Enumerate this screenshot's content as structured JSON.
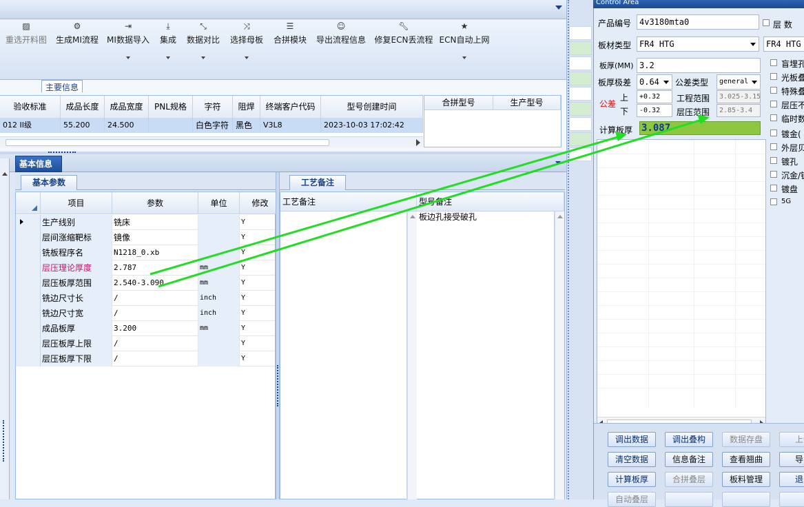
{
  "toolbar": {
    "buttons": [
      {
        "label": "重选开料图",
        "icon": "image-icon"
      },
      {
        "label": "生成MI流程",
        "icon": "gears-icon"
      },
      {
        "label": "MI数据导入",
        "icon": "import-icon"
      },
      {
        "label": "集成",
        "icon": "download-icon"
      },
      {
        "label": "数据对比",
        "icon": "compress-icon"
      },
      {
        "label": "选择母板",
        "icon": "shuffle-icon"
      },
      {
        "label": "合拼模块",
        "icon": "list-icon"
      },
      {
        "label": "导出流程信息",
        "icon": "smile-icon"
      },
      {
        "label": "修复ECN丢流程",
        "icon": "wrench-icon"
      },
      {
        "label": "ECN自动上网",
        "icon": "star-icon"
      }
    ]
  },
  "main_info": {
    "tab": "主要信息",
    "headers": [
      "验收标准",
      "成品长度",
      "成品宽度",
      "PNL规格",
      "字符",
      "阻焊",
      "终端客户代码",
      "型号创建时间"
    ],
    "row": [
      "012 II级",
      "55.200",
      "24.500",
      "",
      "白色字符",
      "黑色",
      "V3L8",
      "2023-10-03 17:02:42"
    ],
    "merge_headers": [
      "合拼型号",
      "生产型号"
    ]
  },
  "basic_info": {
    "tab": "基本信息",
    "params_tab": "基本参数",
    "craft_tab": "工艺备注",
    "headers": [
      "项目",
      "参数",
      "单位",
      "修改"
    ],
    "rows": [
      {
        "item": "生产线别",
        "value": "铣床",
        "unit": "",
        "mod": "Y"
      },
      {
        "item": "层间涨缩靶标",
        "value": "镜像",
        "unit": "",
        "mod": "Y"
      },
      {
        "item": "铣板程序名",
        "value": "N1218_0.xb",
        "unit": "",
        "mod": "Y"
      },
      {
        "item": "层压理论厚度",
        "value": "2.787",
        "unit": "mm",
        "mod": "Y"
      },
      {
        "item": "层压板厚范围",
        "value": "2.540-3.090",
        "unit": "mm",
        "mod": "Y"
      },
      {
        "item": "铣边尺寸长",
        "value": "/",
        "unit": "inch",
        "mod": "Y"
      },
      {
        "item": "铣边尺寸宽",
        "value": "/",
        "unit": "inch",
        "mod": "Y"
      },
      {
        "item": "成品板厚",
        "value": "3.200",
        "unit": "mm",
        "mod": "Y"
      },
      {
        "item": "层压板厚上限",
        "value": "/",
        "unit": "",
        "mod": "Y"
      },
      {
        "item": "层压板厚下限",
        "value": "/",
        "unit": "",
        "mod": "Y"
      }
    ],
    "craft_headers": [
      "工艺备注",
      "型号备注"
    ],
    "model_note": "板边孔接受破孔"
  },
  "control": {
    "title": "Control Area",
    "product_no_label": "产品编号",
    "product_no": "4v3180mta0",
    "layers_label": "层 数",
    "material_label": "板材类型",
    "material": "FR4 HTG",
    "material2": "FR4 HTG",
    "thickness_label": "板厚(MM)",
    "thickness": "3.2",
    "tol_label": "板厚极差",
    "tol": "0.64",
    "tol_type_label": "公差类型",
    "tol_type": "general",
    "tolerance_label": "公差",
    "upper_label": "上",
    "lower_label": "下",
    "upper": "+0.32",
    "lower": "-0.32",
    "eng_range_label": "工程范围",
    "eng_range": "3.025-3.15",
    "lam_range_label": "层压范围",
    "lam_range": "2.85-3.4",
    "calc_label": "计算板厚",
    "calc_value": "3.087",
    "checkboxes": [
      "盲埋孔",
      "光板叠",
      "特殊叠",
      "层压不",
      "临时数",
      "镀金(",
      "外层贝",
      "镀孔",
      "沉金/镀",
      "镀盘",
      "5G"
    ],
    "buttons": [
      [
        "调出数据",
        "调出叠构",
        "数据存盘",
        "上传"
      ],
      [
        "清空数据",
        "信息备注",
        "查看翘曲",
        "导出"
      ],
      [
        "计算板厚",
        "合拼叠层",
        "板料管理",
        "退出"
      ],
      [
        "自动叠层",
        "",
        "",
        ""
      ]
    ]
  },
  "colors": {
    "accent": "#1d4f9b",
    "calc_bg": "#8dc63f",
    "arrow": "#22dd22",
    "red_label": "#c2186f"
  }
}
